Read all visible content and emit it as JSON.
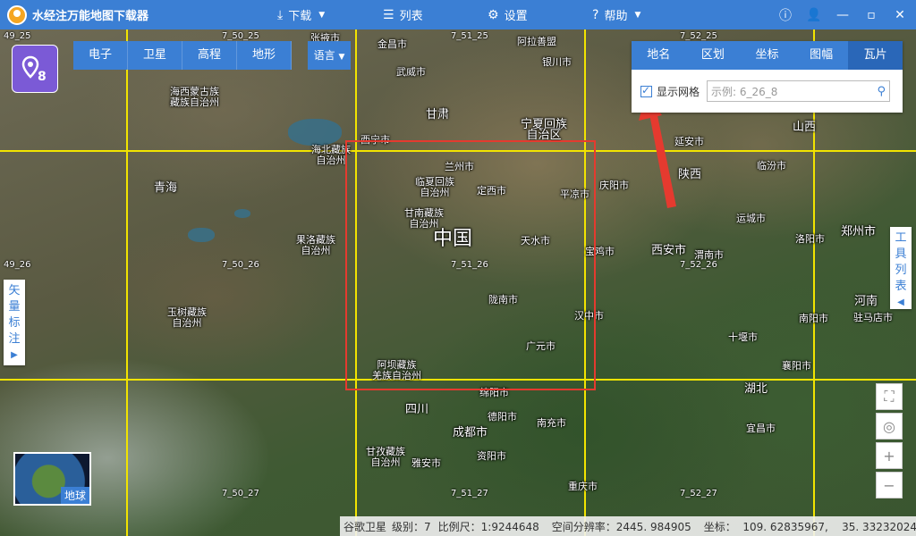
{
  "app": {
    "title": "水经注万能地图下载器"
  },
  "toolbar": {
    "download": "下载",
    "list": "列表",
    "settings": "设置",
    "help": "帮助"
  },
  "map_types": [
    "电子",
    "卫星",
    "高程",
    "地形"
  ],
  "language": "语言",
  "panel": {
    "tabs": [
      "地名",
      "区划",
      "坐标",
      "图幅",
      "瓦片"
    ],
    "active_tab": "瓦片",
    "show_grid_label": "显示网格",
    "show_grid_checked": true,
    "search_placeholder": "示例: 6_26_8"
  },
  "side_tabs": {
    "vector_label": "矢量标注",
    "tool_list": "工具列表"
  },
  "globe_label": "地球",
  "tile_labels": [
    "49_25",
    "7_50_25",
    "7_51_25",
    "7_52_25",
    "49_26",
    "7_50_26",
    "7_51_26",
    "7_52_26",
    "7_50_27",
    "7_51_27",
    "7_52_27"
  ],
  "places": {
    "jinchang": "金昌市",
    "alashan": "阿拉善盟",
    "zhangye": "张掖市",
    "yinchuan": "银川市",
    "haixi": "海西蒙古族\n藏族自治州",
    "wuwei": "武威市",
    "gansu": "甘肃",
    "ningxia": "宁夏回族\n自治区",
    "shanxi": "山西",
    "haibei": "海北藏族\n自治州",
    "xining": "西宁市",
    "yanan": "延安市",
    "shaanxi": "陕西",
    "qinghai": "青海",
    "lanzhou": "兰州市",
    "linxia": "临夏回族\n自治州",
    "dingxi": "定西市",
    "qingyang": "庆阳市",
    "linfen": "临汾市",
    "pingliang": "平凉市",
    "gannan": "甘南藏族\n自治州",
    "yuncheng": "运城市",
    "zhongguo": "中国",
    "tianshui": "天水市",
    "baoji": "宝鸡市",
    "xian": "西安市",
    "weinan": "渭南市",
    "luoyang": "洛阳市",
    "zhengzhou": "郑州市",
    "guoluo": "果洛藏族\n自治州",
    "longnan": "陇南市",
    "henan": "河南",
    "hanzhong": "汉中市",
    "nanyang": "南阳市",
    "zhumadian": "驻马店市",
    "yushu": "玉树藏族\n自治州",
    "guangyuan": "广元市",
    "shiyan": "十堰市",
    "aba": "阿坝藏族\n羌族自治州",
    "xiangyang": "襄阳市",
    "mianyang": "绵阳市",
    "hubei": "湖北",
    "sichuan": "四川",
    "deyang": "德阳市",
    "nanchong": "南充市",
    "yichang": "宜昌市",
    "chengdu": "成都市",
    "ganzi": "甘孜藏族\n自治州",
    "ziyang": "资阳市",
    "yaan": "雅安市",
    "chongqing": "重庆市"
  },
  "status": {
    "source": "谷歌卫星",
    "level": "级别：7",
    "scale": "比例尺：1:9244648",
    "resolution": "空间分辨率：2445. 984905",
    "coords": "坐标：  109. 62835967,    35. 33232024"
  }
}
